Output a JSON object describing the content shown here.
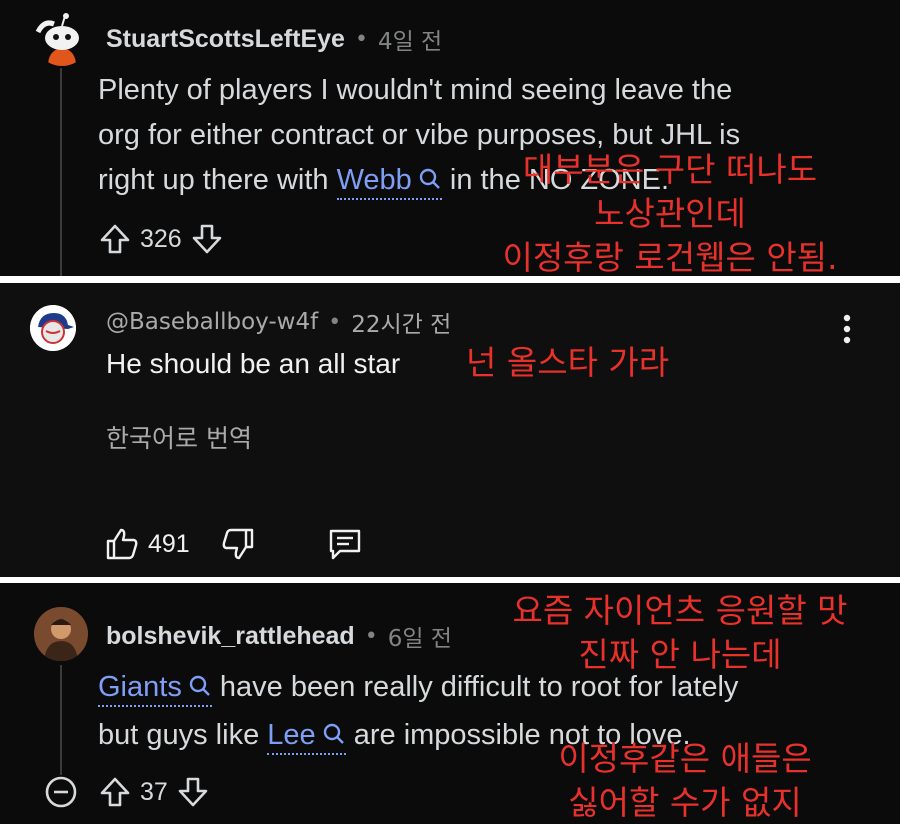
{
  "comments": [
    {
      "username": "StuartScottsLeftEye",
      "separator": "•",
      "time": "4일 전",
      "body_line1": "Plenty of players I wouldn't mind seeing leave the",
      "body_line2": "org for either contract or vibe purposes, but JHL is",
      "body_line3_before": "right up there with",
      "link1": "Webb",
      "body_line3_after": "in the NO ZONE.",
      "score": "326",
      "overlay_lines": [
        "대부분은 구단 떠나도",
        "노상관인데",
        "이정후랑 로건웹은 안됨."
      ]
    },
    {
      "username": "@Baseballboy-w4f",
      "separator": "•",
      "time": "22시간 전",
      "body": "He should be an all star",
      "translate_label": "한국어로 번역",
      "likes": "491",
      "overlay": "넌 올스타 가라"
    },
    {
      "username": "bolshevik_rattlehead",
      "separator": "•",
      "time": "6일 전",
      "link1": "Giants",
      "body_line1_after": "have been really difficult to root for lately",
      "body_line2_before": "but guys like",
      "link2": "Lee",
      "body_line2_after": "are impossible not to love.",
      "score": "37",
      "overlay_lines_top": [
        "요즘 자이언츠 응원할 맛",
        "진짜 안 나는데"
      ],
      "overlay_lines_bottom": [
        "이정후같은 애들은",
        "싫어할 수가 없지"
      ]
    }
  ],
  "colors": {
    "background": "#0b0b0b",
    "text": "#d7dadc",
    "muted": "#818384",
    "link": "#7e9ff5",
    "overlay_red": "#e8312a",
    "separator": "#ffffff"
  },
  "icons": [
    "reddit-avatar-icon",
    "search-icon",
    "upvote-icon",
    "downvote-icon",
    "thumbs-up-icon",
    "thumbs-down-icon",
    "reply-icon",
    "more-vert-icon",
    "collapse-icon"
  ]
}
